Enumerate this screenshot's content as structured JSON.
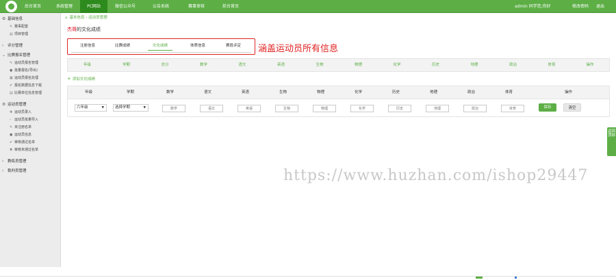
{
  "topnav": {
    "items": [
      {
        "label": "后台首页",
        "active": false
      },
      {
        "label": "系统管理",
        "active": false
      },
      {
        "label": "PC网站",
        "active": true
      },
      {
        "label": "微信公众号",
        "active": false
      },
      {
        "label": "公告系统",
        "active": false
      },
      {
        "label": "赛事审核",
        "active": false
      },
      {
        "label": "前台首页",
        "active": false
      }
    ],
    "user_text": "admin 同学您,你好",
    "change_pwd": "修改密码",
    "logout": "退出"
  },
  "sidebar": {
    "groups": [
      {
        "label": "基础信息",
        "icon": "gear",
        "items": [
          {
            "label": "赛事配置",
            "icon": "wrench"
          },
          {
            "label": "项目管理",
            "icon": "doc"
          }
        ]
      },
      {
        "label": "评分管理",
        "icon": "arrow",
        "items": []
      },
      {
        "label": "比赛报名管理",
        "icon": "arrow-down",
        "items": [
          {
            "label": "运动员报名管理",
            "icon": "wrench"
          },
          {
            "label": "批量报名(导出)",
            "icon": "user"
          },
          {
            "label": "运动员报名处理",
            "icon": "grid"
          },
          {
            "label": "报名数据信息下载",
            "icon": "pen"
          },
          {
            "label": "比赛单位信息管理",
            "icon": "doc"
          }
        ]
      },
      {
        "label": "运动员管理",
        "icon": "gear",
        "items": [
          {
            "label": "运动员录入",
            "icon": "plus"
          },
          {
            "label": "运动员批量导入",
            "icon": "arrow"
          },
          {
            "label": "未注册名单",
            "icon": "wrench"
          },
          {
            "label": "运动员信息",
            "icon": "user"
          },
          {
            "label": "审核通过名单",
            "icon": "check"
          },
          {
            "label": "审核未通过名单",
            "icon": "cross"
          }
        ]
      },
      {
        "label": "教练员管理",
        "icon": "arrow",
        "items": []
      },
      {
        "label": "裁判员管理",
        "icon": "arrow",
        "items": []
      }
    ]
  },
  "breadcrumb": {
    "home": "首页",
    "level1": "基本信息",
    "level2": "运动员管理"
  },
  "page_title": {
    "highlight": "杰哥",
    "rest": "的文化成绩"
  },
  "tabs": [
    {
      "label": "注册信息",
      "active": false
    },
    {
      "label": "比赛成绩",
      "active": false
    },
    {
      "label": "文化成绩",
      "active": true
    },
    {
      "label": "体质信息",
      "active": false
    },
    {
      "label": "赛段评定",
      "active": false
    }
  ],
  "annotation": "涵盖运动员所有信息",
  "summary_headers": [
    "年级",
    "学期",
    "总分",
    "数学",
    "语文",
    "英语",
    "生物",
    "物理",
    "化学",
    "历史",
    "地理",
    "政治",
    "体育",
    "操作"
  ],
  "add_link": "添加文化成绩",
  "edit_headers": [
    "年级",
    "学期",
    "数学",
    "语文",
    "英语",
    "生物",
    "物理",
    "化学",
    "历史",
    "地理",
    "政治",
    "体育",
    "操作"
  ],
  "edit_row": {
    "grade": "六年级",
    "term": "选择学期",
    "placeholders": [
      "数学",
      "语文",
      "英语",
      "生物",
      "物理",
      "化学",
      "历史",
      "地理",
      "政治",
      "体育"
    ],
    "save": "保存",
    "clear": "清空"
  },
  "watermark": "https://www.huzhan.com/ishop29447",
  "float_tab": "返回顶部"
}
